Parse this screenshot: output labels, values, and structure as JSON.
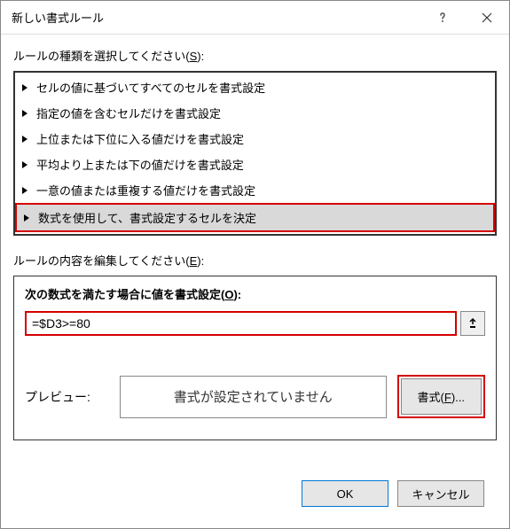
{
  "titlebar": {
    "title": "新しい書式ルール"
  },
  "labels": {
    "rule_type_prefix": "ルールの種類を選択してください(",
    "rule_type_access": "S",
    "rule_type_suffix": "):",
    "rule_edit_prefix": "ルールの内容を編集してください(",
    "rule_edit_access": "E",
    "rule_edit_suffix": "):",
    "formula_prefix": "次の数式を満たす場合に値を書式設定(",
    "formula_access": "O",
    "formula_suffix": "):",
    "preview": "プレビュー:",
    "preview_none": "書式が設定されていません",
    "format_btn_prefix": "書式(",
    "format_btn_access": "F",
    "format_btn_suffix": ")..."
  },
  "rule_types": [
    "セルの値に基づいてすべてのセルを書式設定",
    "指定の値を含むセルだけを書式設定",
    "上位または下位に入る値だけを書式設定",
    "平均より上または下の値だけを書式設定",
    "一意の値または重複する値だけを書式設定",
    "数式を使用して、書式設定するセルを決定"
  ],
  "selected_rule_index": 5,
  "formula_value": "=$D3>=80",
  "footer": {
    "ok": "OK",
    "cancel": "キャンセル"
  }
}
